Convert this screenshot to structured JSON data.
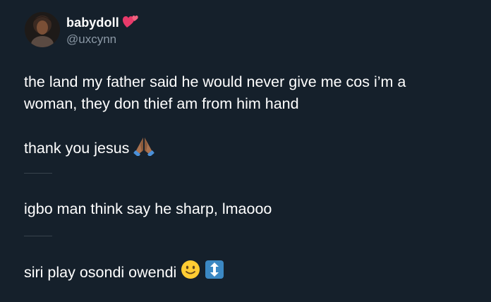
{
  "author": {
    "display_name": "babydoll",
    "name_emoji": "two-hearts-emoji",
    "handle": "@uxcynn",
    "avatar": "profile-photo"
  },
  "tweet": {
    "paragraph1_line1": "the land my father said he would never give me cos i’m a",
    "paragraph1_line2": "woman, they don thief am from him hand",
    "paragraph2": "thank you jesus",
    "paragraph2_emoji": "folded-hands-emoji",
    "paragraph3": "igbo man think say he sharp, lmaooo",
    "paragraph4": "siri play osondi owendi",
    "paragraph4_emojis": [
      "slightly-smiling-face-emoji",
      "up-down-arrow-emoji"
    ]
  },
  "colors": {
    "background": "#15202b",
    "text_primary": "#ffffff",
    "text_secondary": "#8b98a5",
    "divider": "#38444d"
  }
}
